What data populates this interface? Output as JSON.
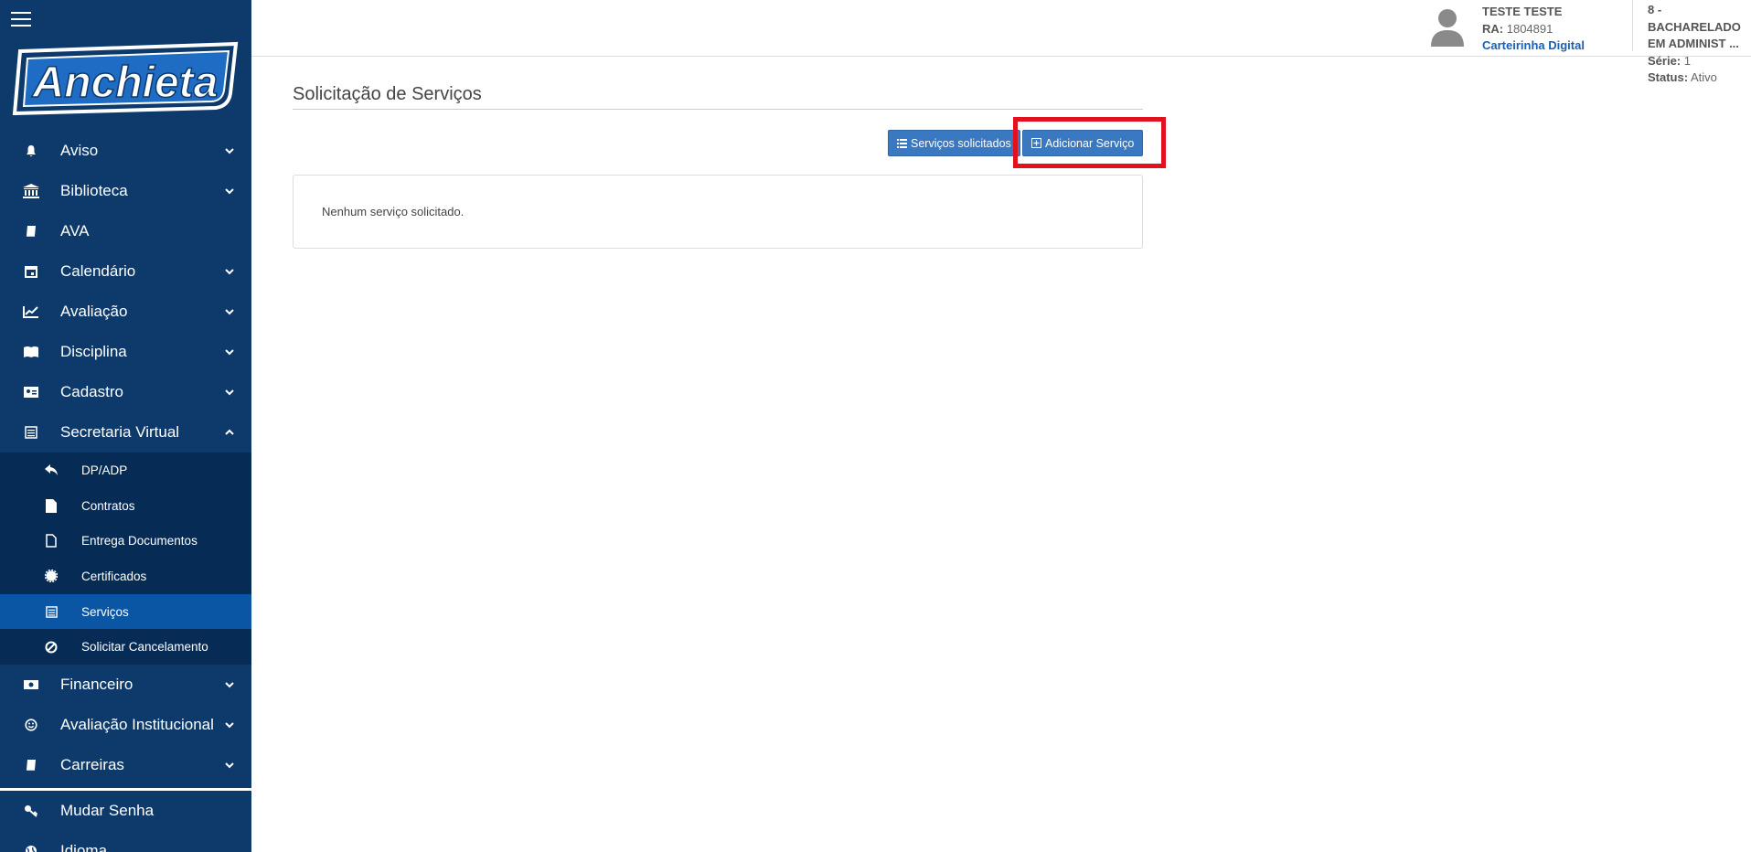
{
  "sidebar": {
    "logo_text": "Anchieta",
    "items": [
      {
        "label": "Aviso",
        "icon": "bell-icon",
        "chevron": "down"
      },
      {
        "label": "Biblioteca",
        "icon": "bank-icon",
        "chevron": "down"
      },
      {
        "label": "AVA",
        "icon": "book-icon",
        "chevron": ""
      },
      {
        "label": "Calendário",
        "icon": "calendar-icon",
        "chevron": "down"
      },
      {
        "label": "Avaliação",
        "icon": "chart-line-icon",
        "chevron": "down"
      },
      {
        "label": "Disciplina",
        "icon": "open-book-icon",
        "chevron": "down"
      },
      {
        "label": "Cadastro",
        "icon": "id-card-icon",
        "chevron": "down"
      },
      {
        "label": "Secretaria Virtual",
        "icon": "newspaper-icon",
        "chevron": "up"
      }
    ],
    "sub_items": [
      {
        "label": "DP/ADP",
        "icon": "reply-icon"
      },
      {
        "label": "Contratos",
        "icon": "file-icon"
      },
      {
        "label": "Entrega Documentos",
        "icon": "file-outline-icon"
      },
      {
        "label": "Certificados",
        "icon": "certificate-icon"
      },
      {
        "label": "Serviços",
        "icon": "newspaper-icon"
      },
      {
        "label": "Solicitar Cancelamento",
        "icon": "ban-icon"
      }
    ],
    "items_after": [
      {
        "label": "Financeiro",
        "icon": "money-icon",
        "chevron": "down"
      },
      {
        "label": "Avaliação Institucional",
        "icon": "smile-icon",
        "chevron": "down"
      },
      {
        "label": "Carreiras",
        "icon": "book-icon",
        "chevron": "down"
      }
    ],
    "bottom_items": [
      {
        "label": "Mudar Senha",
        "icon": "key-icon"
      },
      {
        "label": "Idioma",
        "icon": "globe-icon"
      }
    ]
  },
  "header": {
    "user_name": "TESTE TESTE",
    "ra_label": "RA:",
    "ra_value": "1804891",
    "card_link": "Carteirinha Digital",
    "course": "8 - BACHARELADO EM ADMINIST ...",
    "serie_label": "Série:",
    "serie_value": "1",
    "status_label": "Status:",
    "status_value": "Ativo"
  },
  "main": {
    "title": "Solicitação de Serviços",
    "btn_list": "Serviços solicitados",
    "btn_add": "Adicionar Serviço",
    "empty_message": "Nenhum serviço solicitado."
  },
  "colors": {
    "sidebar": "#0d3a6b",
    "submenu": "#062c55",
    "active": "#0b56a4",
    "button": "#3a78c2",
    "highlight": "#e3101e"
  }
}
